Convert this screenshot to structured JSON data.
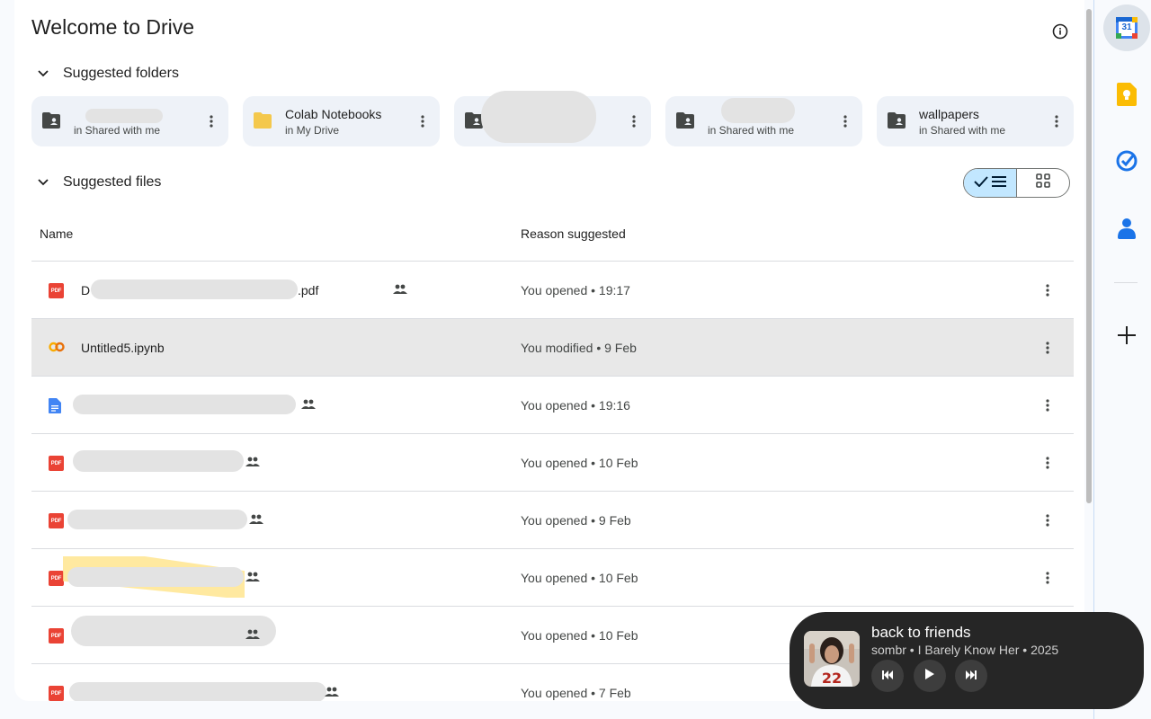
{
  "header": {
    "title": "Welcome to Drive",
    "info_icon": "info-icon"
  },
  "sections": {
    "folders_label": "Suggested folders",
    "files_label": "Suggested files"
  },
  "folders": [
    {
      "name": "",
      "location": "in Shared with me",
      "icon": "shared-folder-icon"
    },
    {
      "name": "Colab Notebooks",
      "location": "in My Drive",
      "icon": "folder-icon"
    },
    {
      "name": "",
      "location": "",
      "icon": "shared-folder-icon"
    },
    {
      "name": "",
      "location": "in Shared with me",
      "icon": "shared-folder-icon"
    },
    {
      "name": "wallpapers",
      "location": "in Shared with me",
      "icon": "shared-folder-icon"
    }
  ],
  "columns": {
    "name": "Name",
    "reason": "Reason suggested"
  },
  "files": [
    {
      "name": "D",
      "name_end": ".pdf",
      "type": "pdf",
      "shared": true,
      "reason": "You opened • 19:17"
    },
    {
      "name": "Untitled5.ipynb",
      "name_end": "",
      "type": "colab",
      "shared": false,
      "reason": "You modified • 9 Feb"
    },
    {
      "name": "",
      "name_end": "",
      "type": "doc",
      "shared": true,
      "reason": "You opened • 19:16"
    },
    {
      "name": "",
      "name_end": "",
      "type": "pdf",
      "shared": true,
      "reason": "You opened • 10 Feb"
    },
    {
      "name": "",
      "name_end": "",
      "type": "pdf",
      "shared": true,
      "reason": "You opened • 9 Feb"
    },
    {
      "name": "",
      "name_end": "",
      "type": "pdf",
      "shared": true,
      "reason": "You opened • 10 Feb"
    },
    {
      "name": "",
      "name_end": "",
      "type": "pdf",
      "shared": true,
      "reason": "You opened • 10 Feb"
    },
    {
      "name": "",
      "name_end": "",
      "type": "pdf",
      "shared": true,
      "reason": "You opened • 7 Feb"
    }
  ],
  "pdf_badge": "PDF",
  "side_panel": {
    "calendar_day": "31",
    "items": [
      "calendar-icon",
      "keep-icon",
      "tasks-icon",
      "contacts-icon",
      "add-icon"
    ]
  },
  "player": {
    "title": "back to friends",
    "meta": "sombr • I Barely Know Her • 2025",
    "album_number": "22"
  },
  "colors": {
    "accent": "#0b57d0",
    "selected_toggle": "#c2e7ff",
    "pdf": "#ea4335",
    "player_bg": "#262626"
  }
}
